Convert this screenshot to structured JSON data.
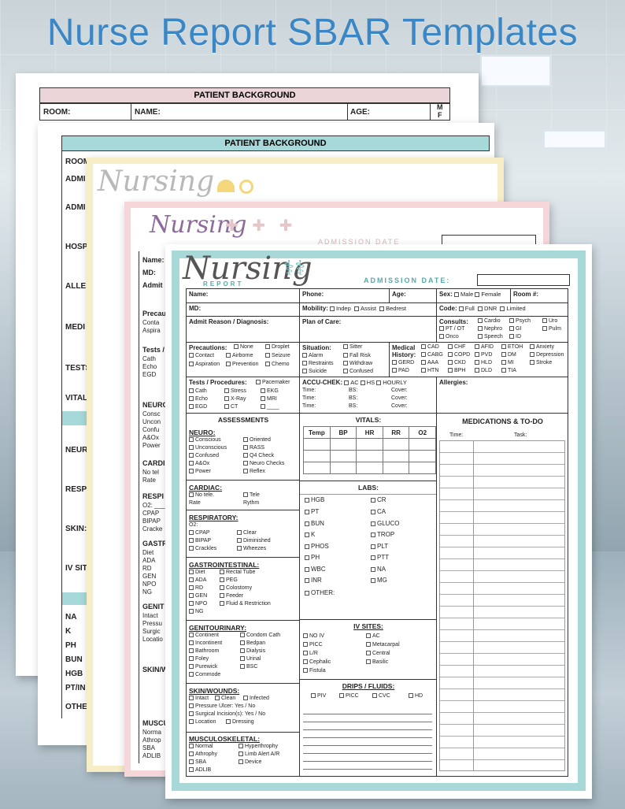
{
  "headline": "Nurse Report SBAR Templates",
  "sheet1": {
    "title": "PATIENT BACKGROUND",
    "room": "ROOM:",
    "name": "NAME:",
    "age": "AGE:",
    "m": "M",
    "f": "F"
  },
  "sheet2": {
    "title": "PATIENT BACKGROUND",
    "rows": [
      "ROOM",
      "ADMI",
      "ADMI",
      "HOSP",
      "ALLE",
      "MEDI",
      "TESTS",
      "VITAL",
      "NEUR",
      "RESP",
      "SKIN:",
      "IV SIT",
      "NA",
      "K",
      "PH",
      "BUN",
      "HGB",
      "PT/IN",
      "OTHE"
    ]
  },
  "sheet3": {
    "script": "Nursing"
  },
  "sheet4": {
    "script": "Nursing",
    "sub": "REPORT",
    "admission": "ADMISSION DATE",
    "rows": [
      "Name:",
      "MD:",
      "Admit",
      "Precau",
      "Conta",
      "Aspira",
      "Tests /",
      "Cath",
      "Echo",
      "EGD",
      "NEURO",
      "Consc",
      "Uncon",
      "Confu",
      "A&Ox",
      "Power",
      "CARDI",
      "No tel",
      "Rate",
      "RESPI",
      "O2: ___",
      "CPAP",
      "BIPAP",
      "Cracke",
      "GASTR",
      "Diet",
      "ADA",
      "RD",
      "GEN",
      "NPO",
      "NG",
      "GENIT",
      "Intact",
      "Pressu",
      "Surgic",
      "Locatio",
      "SKIN/W",
      "MUSCU",
      "Norma",
      "Athrop",
      "SBA",
      "ADLIB"
    ]
  },
  "form": {
    "script": "Nursing",
    "sub": "REPORT",
    "admission": "ADMISSION DATE:",
    "name": "Name:",
    "phone": "Phone:",
    "age": "Age:",
    "sex": "Sex:",
    "male": "Male",
    "female": "Female",
    "room": "Room #:",
    "md": "MD:",
    "mobility": "Mobility:",
    "indep": "Indep",
    "assist": "Assist",
    "bedrest": "Bedrest",
    "code": "Code:",
    "full": "Full",
    "dnr": "DNR",
    "limited": "Limited",
    "admit": "Admit Reason / Diagnosis:",
    "plan": "Plan of Care:",
    "consults": "Consults:",
    "consult_opts": [
      "Cardio",
      "Psych",
      "Uro",
      "PT / OT",
      "Nephro",
      "GI",
      "Pulm",
      "Onco",
      "Speech",
      "ID"
    ],
    "precautions": "Precautions:",
    "prec_opts": [
      "None",
      "Droplet",
      "Contact",
      "Airborne",
      "Seizure",
      "Aspiration",
      "Prevention",
      "Chemo"
    ],
    "situation": "Situation:",
    "sit_opts": [
      "Sitter",
      "Alarm",
      "Fall Risk",
      "Restraints",
      "Withdraw",
      "Suicide",
      "Confused"
    ],
    "medical": "Medical",
    "history": "History:",
    "hist_opts": [
      "CAD",
      "CHF",
      "AFID",
      "ETOH",
      "Anxiety",
      "CABG",
      "COPD",
      "PVD",
      "DM",
      "Depression",
      "GERD",
      "AAA",
      "CKD",
      "HLD",
      "MI",
      "Stroke",
      "PAD",
      "HTN",
      "BPH",
      "DLD",
      "TIA"
    ],
    "tests": "Tests / Procedures:",
    "test_opts": [
      "Pacemaker",
      "Cath",
      "Stress",
      "EKG",
      "Echo",
      "X-Ray",
      "MRI",
      "EGD",
      "CT"
    ],
    "accu": "ACCU-CHEK:",
    "ac": "AC",
    "hs": "HS",
    "hourly": "HOURLY",
    "time": "Time:",
    "bs": "BS:",
    "cover": "Cover:",
    "allergies": "Allergies:",
    "assessments": "ASSESSMENTS",
    "neuro": "NEURO:",
    "neuro_opts": [
      "Conscious",
      "Oriented",
      "Unconscious",
      "RASS",
      "Confused",
      "Q4 Check",
      "A&Ox",
      "Neuro Checks",
      "Power",
      "Reflex"
    ],
    "cardiac": "CARDIAC:",
    "no_tele": "No tele.",
    "tele": "Tele",
    "rate": "Rate",
    "rythm": "Rythm",
    "respiratory": "RESPIRATORY:",
    "o2": "O2:",
    "resp_opts": [
      "CPAP",
      "Clear",
      "BIPAP",
      "Diminished",
      "Crackles",
      "Wheezes"
    ],
    "gastro": "GASTROINTESTINAL:",
    "gi_opts": [
      "Diet",
      "Rectal Tube",
      "ADA",
      "PEG",
      "RD",
      "Colostomy",
      "GEN",
      "Feeder",
      "NPO",
      "Fluid & Restriction",
      "NG"
    ],
    "genito": "GENITOURINARY:",
    "gu_opts": [
      "Continent",
      "Condom Cath",
      "Incontinent",
      "Bedpan",
      "Bathroom",
      "Dialysis",
      "Foley",
      "Urinal",
      "Purewick",
      "BSC",
      "Commode"
    ],
    "skin": "SKIN/WOUNDS:",
    "skin_opts": [
      "Intact",
      "Clean",
      "Infected"
    ],
    "pressure": "Pressure Ulcer:  Yes / No",
    "surgical": "Surgical Incision(s):  Yes / No",
    "location": "Location",
    "dressing": "Dressing",
    "musculo": "MUSCULOSKELETAL:",
    "msk_opts": [
      "Normal",
      "Hyperthrophy",
      "Athrophy",
      "Limb Alert A/R",
      "SBA",
      "Device",
      "ADLIB"
    ],
    "vitals": "VITALS:",
    "vitals_cols": [
      "Temp",
      "BP",
      "HR",
      "RR",
      "O2"
    ],
    "labs": "LABS:",
    "labs_opts": [
      "HGB",
      "CR",
      "PT",
      "CA",
      "BUN",
      "GLUCO",
      "K",
      "TROP",
      "PHOS",
      "PLT",
      "PH",
      "PTT",
      "WBC",
      "NA",
      "INR",
      "MG"
    ],
    "other": "OTHER:",
    "iv": "IV SITES:",
    "iv_opts": [
      "NO IV",
      "AC",
      "PICC",
      "Metacarpal",
      "L/R",
      "Central",
      "Cephalic",
      "Basilic",
      "Fistula"
    ],
    "drips": "DRIPS / FLUIDS:",
    "drip_opts": [
      "PIV",
      "PICC",
      "CVC",
      "HD"
    ],
    "meds": "MEDICATIONS & TO-DO",
    "meds_time": "Time:",
    "meds_task": "Task:"
  }
}
